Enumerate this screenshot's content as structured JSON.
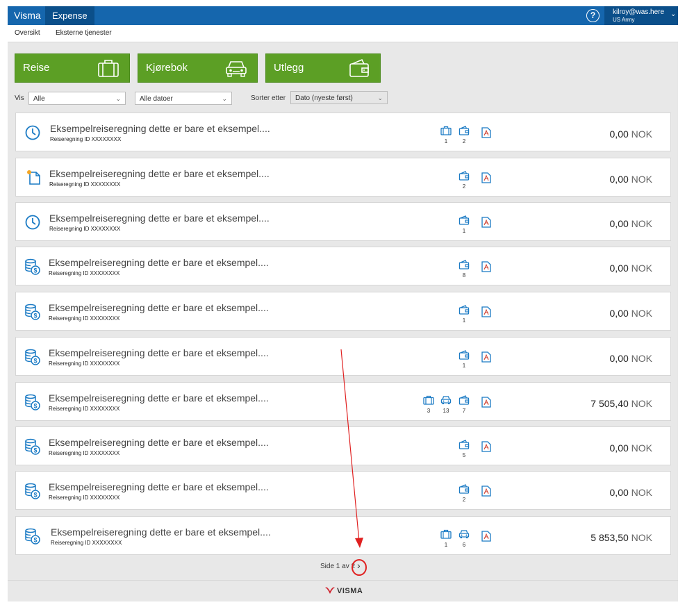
{
  "header": {
    "brand": "Visma",
    "module": "Expense",
    "help": "?",
    "user_name": "kilroy@was.here",
    "user_org": "US Army",
    "user_chevron": "⌄"
  },
  "subnav": {
    "items": [
      "Oversikt",
      "Eksterne tjenester"
    ]
  },
  "tiles": {
    "reise": "Reise",
    "kjorebok": "Kjørebok",
    "utlegg": "Utlegg"
  },
  "filters": {
    "vis_label": "Vis",
    "vis_value": "Alle",
    "dates_value": "Alle datoer",
    "sort_label": "Sorter etter",
    "sort_value": "Dato (nyeste først)"
  },
  "reports": [
    {
      "status_icon": "clock-icon",
      "title": "Eksempelreiseregning dette er bare et eksempel....",
      "subtitle": "Reiseregning ID XXXXXXXX",
      "counts": {
        "travel": "1",
        "receipt": "2"
      },
      "amount": "0,00",
      "currency": "NOK"
    },
    {
      "status_icon": "new-document-icon",
      "title": "Eksempelreiseregning dette er bare et eksempel....",
      "subtitle": "Reiseregning ID XXXXXXXX",
      "counts": {
        "receipt": "2"
      },
      "amount": "0,00",
      "currency": "NOK"
    },
    {
      "status_icon": "clock-icon",
      "title": "Eksempelreiseregning dette er bare et eksempel....",
      "subtitle": "Reiseregning ID XXXXXXXX",
      "counts": {
        "receipt": "1"
      },
      "amount": "0,00",
      "currency": "NOK"
    },
    {
      "status_icon": "coins-icon",
      "title": "Eksempelreiseregning dette er bare et eksempel....",
      "subtitle": "Reiseregning ID XXXXXXXX",
      "counts": {
        "receipt": "8"
      },
      "amount": "0,00",
      "currency": "NOK"
    },
    {
      "status_icon": "coins-icon",
      "title": "Eksempelreiseregning dette er bare et eksempel....",
      "subtitle": "Reiseregning ID XXXXXXXX",
      "counts": {
        "receipt": "1"
      },
      "amount": "0,00",
      "currency": "NOK"
    },
    {
      "status_icon": "coins-icon",
      "title": "Eksempelreiseregning dette er bare et eksempel....",
      "subtitle": "Reiseregning ID XXXXXXXX",
      "counts": {
        "receipt": "1"
      },
      "amount": "0,00",
      "currency": "NOK"
    },
    {
      "status_icon": "coins-icon",
      "title": "Eksempelreiseregning dette er bare et eksempel....",
      "subtitle": "Reiseregning ID XXXXXXXX",
      "counts": {
        "travel": "3",
        "car": "13",
        "receipt": "7"
      },
      "amount": "7 505,40",
      "currency": "NOK"
    },
    {
      "status_icon": "coins-icon",
      "title": "Eksempelreiseregning dette er bare et eksempel....",
      "subtitle": "Reiseregning ID XXXXXXXX",
      "counts": {
        "receipt": "5"
      },
      "amount": "0,00",
      "currency": "NOK"
    },
    {
      "status_icon": "coins-icon",
      "title": "Eksempelreiseregning dette er bare et eksempel....",
      "subtitle": "Reiseregning ID XXXXXXXX",
      "counts": {
        "receipt": "2"
      },
      "amount": "0,00",
      "currency": "NOK"
    },
    {
      "status_icon": "coins-icon",
      "title": "Eksempelreiseregning dette er bare et eksempel....",
      "subtitle": "Reiseregning ID XXXXXXXX",
      "counts": {
        "travel": "1",
        "car": "6"
      },
      "amount": "5 853,50",
      "currency": "NOK"
    }
  ],
  "pagination": {
    "text": "Side 1 av 2",
    "next_glyph": "›"
  },
  "footer": {
    "logo_text": "VISMA"
  },
  "colors": {
    "header_blue": "#1566ad",
    "tile_green": "#5c9f25",
    "icon_blue": "#1a7ac4",
    "annotation_red": "#e02020"
  }
}
